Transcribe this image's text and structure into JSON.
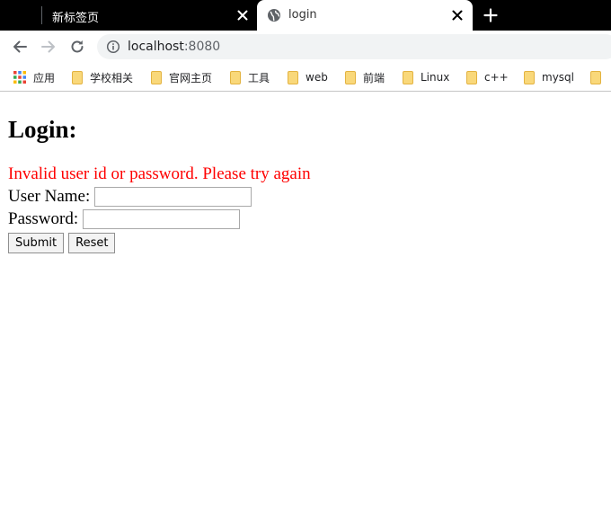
{
  "browser": {
    "tabs": [
      {
        "title": "新标签页",
        "active": false
      },
      {
        "title": "login",
        "active": true
      }
    ],
    "address": {
      "host": "localhost",
      "port": ":8080"
    },
    "bookmarks": [
      {
        "label": "应用",
        "icon": "apps-grid-icon"
      },
      {
        "label": "学校相关",
        "icon": "folder-icon"
      },
      {
        "label": "官网主页",
        "icon": "folder-icon"
      },
      {
        "label": "工具",
        "icon": "folder-icon"
      },
      {
        "label": "web",
        "icon": "folder-icon"
      },
      {
        "label": "前端",
        "icon": "folder-icon"
      },
      {
        "label": "Linux",
        "icon": "folder-icon"
      },
      {
        "label": "c++",
        "icon": "folder-icon"
      },
      {
        "label": "mysql",
        "icon": "folder-icon"
      }
    ]
  },
  "page": {
    "title": "Login:",
    "error": "Invalid user id or password. Please try again",
    "form": {
      "username_label": "User Name:",
      "username_value": "",
      "password_label": "Password:",
      "password_value": "",
      "submit_label": "Submit",
      "reset_label": "Reset"
    }
  },
  "colors": {
    "error": "#ff0000",
    "tabstrip": "#000000",
    "folder": "#f9d87a"
  }
}
